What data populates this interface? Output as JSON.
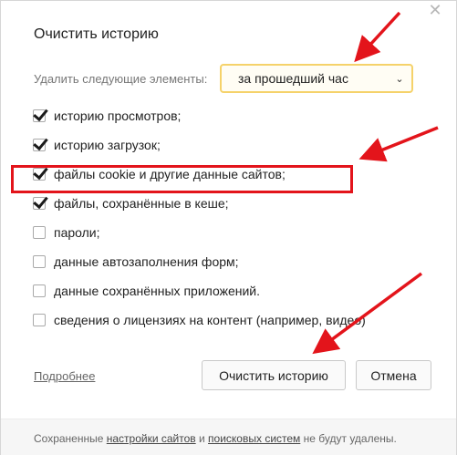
{
  "dialog": {
    "title": "Очистить историю",
    "close_icon": "close-icon",
    "delete_label": "Удалить следующие элементы:",
    "period_select": {
      "value": "за прошедший час"
    },
    "options": [
      {
        "label": "историю просмотров;",
        "checked": true
      },
      {
        "label": "историю загрузок;",
        "checked": true
      },
      {
        "label": "файлы cookie и другие данные сайтов;",
        "checked": true
      },
      {
        "label": "файлы, сохранённые в кеше;",
        "checked": true
      },
      {
        "label": "пароли;",
        "checked": false
      },
      {
        "label": "данные автозаполнения форм;",
        "checked": false
      },
      {
        "label": "данные сохранённых приложений.",
        "checked": false
      },
      {
        "label": "сведения о лицензиях на контент (например, видео)",
        "checked": false
      }
    ],
    "details_link": "Подробнее",
    "clear_button": "Очистить историю",
    "cancel_button": "Отмена",
    "footer": {
      "prefix": "Сохраненные ",
      "link1": "настройки сайтов",
      "middle": " и ",
      "link2": "поисковых систем",
      "suffix": " не будут удалены."
    }
  },
  "colors": {
    "annotation_red": "#e3141b",
    "select_border": "#f5d26a"
  }
}
